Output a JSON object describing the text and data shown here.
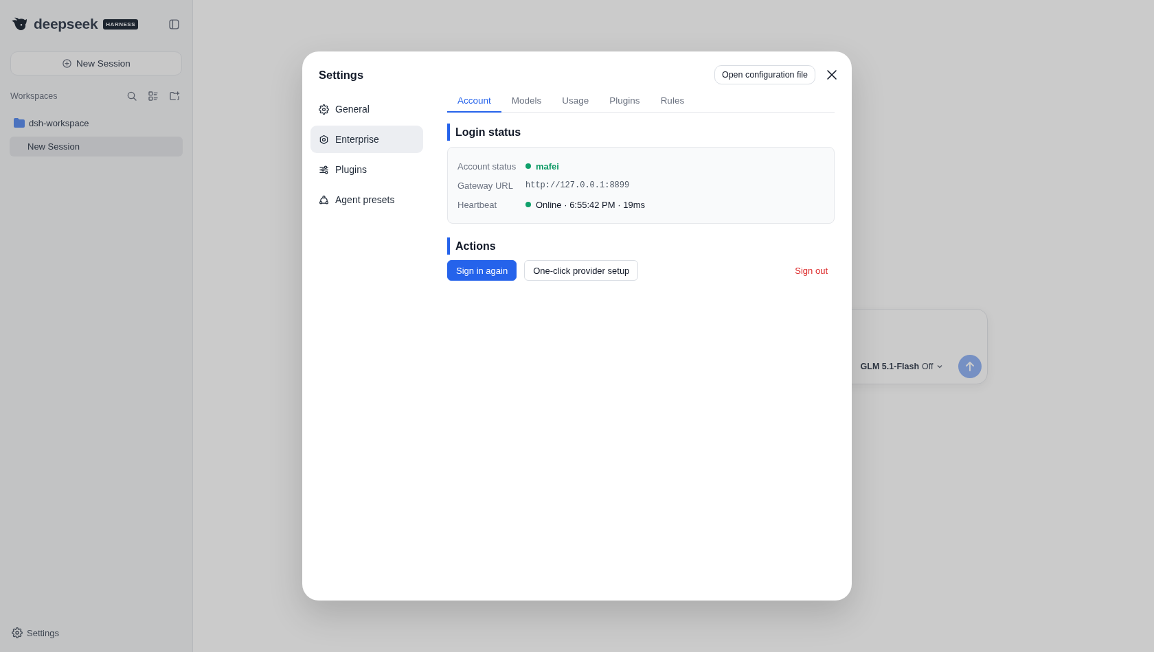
{
  "sidebar": {
    "logo": "deepseek",
    "badge": "HARNESS",
    "new_session_button": "New Session",
    "workspaces_label": "Workspaces",
    "workspaces": [
      {
        "name": "dsh-workspace",
        "sessions": [
          {
            "title": "New Session",
            "selected": true
          }
        ]
      }
    ],
    "settings_link": "Settings"
  },
  "composer": {
    "model": "GLM 5.1-Flash",
    "mode": "Off"
  },
  "dialog": {
    "title": "Settings",
    "open_config_button": "Open configuration file",
    "nav": [
      {
        "label": "General",
        "selected": false
      },
      {
        "label": "Enterprise",
        "selected": true
      },
      {
        "label": "Plugins",
        "selected": false
      },
      {
        "label": "Agent presets",
        "selected": false
      }
    ],
    "tabs": [
      {
        "label": "Account",
        "selected": true
      },
      {
        "label": "Models",
        "selected": false
      },
      {
        "label": "Usage",
        "selected": false
      },
      {
        "label": "Plugins",
        "selected": false
      },
      {
        "label": "Rules",
        "selected": false
      }
    ],
    "login_status": {
      "title": "Login status",
      "rows": [
        {
          "label": "Account status",
          "value": "mafei",
          "kind": "user"
        },
        {
          "label": "Gateway URL",
          "value": "http://127.0.0.1:8899",
          "kind": "url"
        },
        {
          "label": "Heartbeat",
          "value": "Online · 6:55:42 PM · 19ms",
          "kind": "status"
        }
      ]
    },
    "actions": {
      "title": "Actions",
      "buttons": [
        {
          "label": "Sign in again",
          "kind": "primary"
        },
        {
          "label": "One-click provider setup",
          "kind": "secondary"
        },
        {
          "label": "Sign out",
          "kind": "danger"
        }
      ]
    }
  }
}
